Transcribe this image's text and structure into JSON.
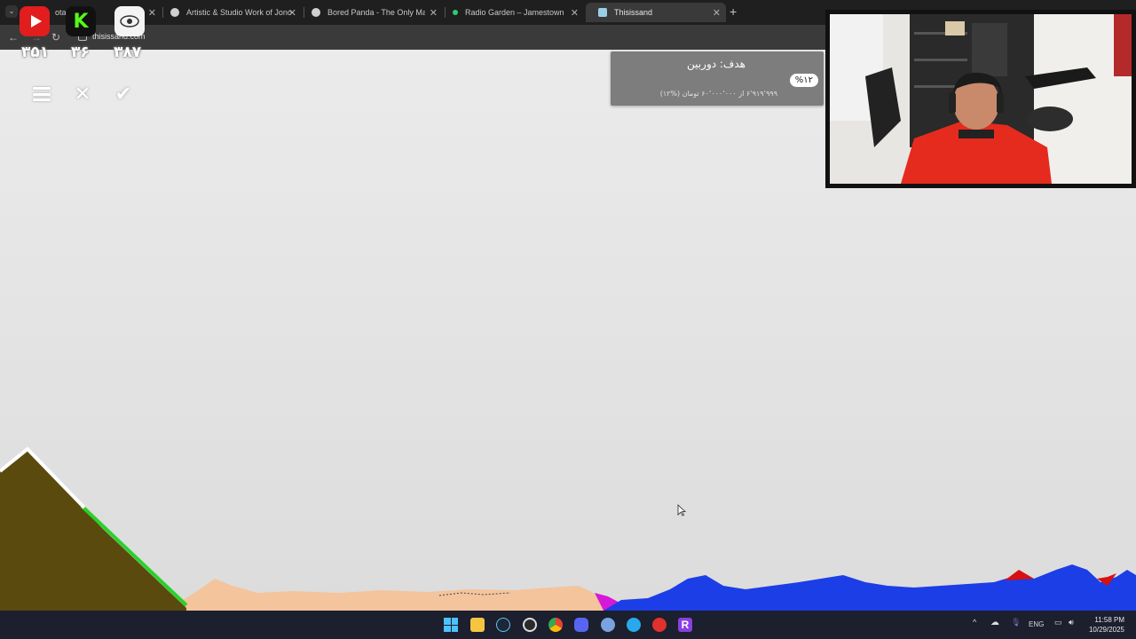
{
  "browser": {
    "tabs": [
      {
        "title": "otatap",
        "favicon_color": "#f6c343",
        "active": false
      },
      {
        "title": "Artistic & Studio Work of Jono",
        "favicon_color": "#d0d0d0",
        "active": false
      },
      {
        "title": "Bored Panda - The Only Magaz",
        "favicon_color": "#d0d0d0",
        "active": false
      },
      {
        "title": "Radio Garden – Jamestown",
        "favicon_color": "#2ecc71",
        "active": false
      },
      {
        "title": "Thisissand",
        "favicon_color": "#9ad0e6",
        "active": true
      }
    ],
    "url": "thisissand.com"
  },
  "overlay": {
    "counters": [
      "۳۵۱",
      "۳۶",
      "۳۸۷"
    ],
    "social_icons": [
      "youtube-icon",
      "kick-icon",
      "eye-icon"
    ]
  },
  "sand_toolbar": {
    "icons": [
      "menu-icon",
      "close-icon",
      "check-icon"
    ]
  },
  "donation_goal": {
    "title": "هدف: دوربین",
    "percent": "%۱۲",
    "amount": "۶٬۹۱۹٬۹۹۹ از ۶۰٬۰۰۰٬۰۰۰ تومان (%۱۲)",
    "progress": 0.12
  },
  "taskbar": {
    "apps": [
      "windows-start-icon",
      "file-explorer-icon",
      "steam-icon",
      "obs-icon",
      "chrome-icon",
      "discord-icon",
      "app-icon",
      "telegram-icon",
      "app-red-icon",
      "r-app-icon"
    ],
    "tray": {
      "language": "ENG",
      "time": "11:58 PM",
      "date": "10/29/2025"
    }
  },
  "colors": {
    "sand_dark": "#5a4a0e",
    "sand_light": "#f4c49c",
    "water": "#1c3ee6",
    "lava": "#d81010",
    "plant": "#2bd12b",
    "magenta": "#d619d6"
  }
}
